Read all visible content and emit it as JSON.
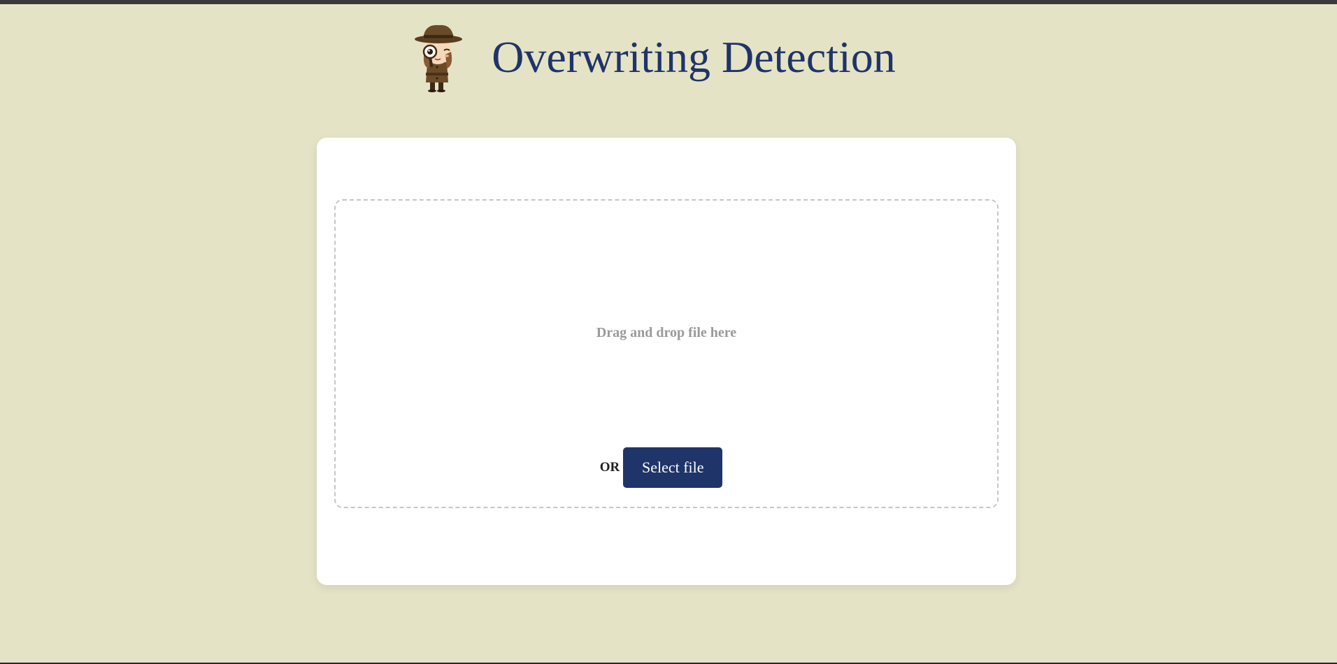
{
  "header": {
    "title": "Overwriting Detection",
    "logo_icon": "detective-mascot-icon"
  },
  "upload": {
    "drop_text": "Drag and drop file here",
    "or_text": "OR",
    "select_button_label": "Select file"
  },
  "colors": {
    "page_background": "#e5e3c6",
    "title": "#1f3468",
    "button_background": "#1f3468",
    "button_text": "#ffffff",
    "card_background": "#ffffff",
    "dropzone_border": "#c6c6c6",
    "drop_text": "#9a9a9a"
  }
}
